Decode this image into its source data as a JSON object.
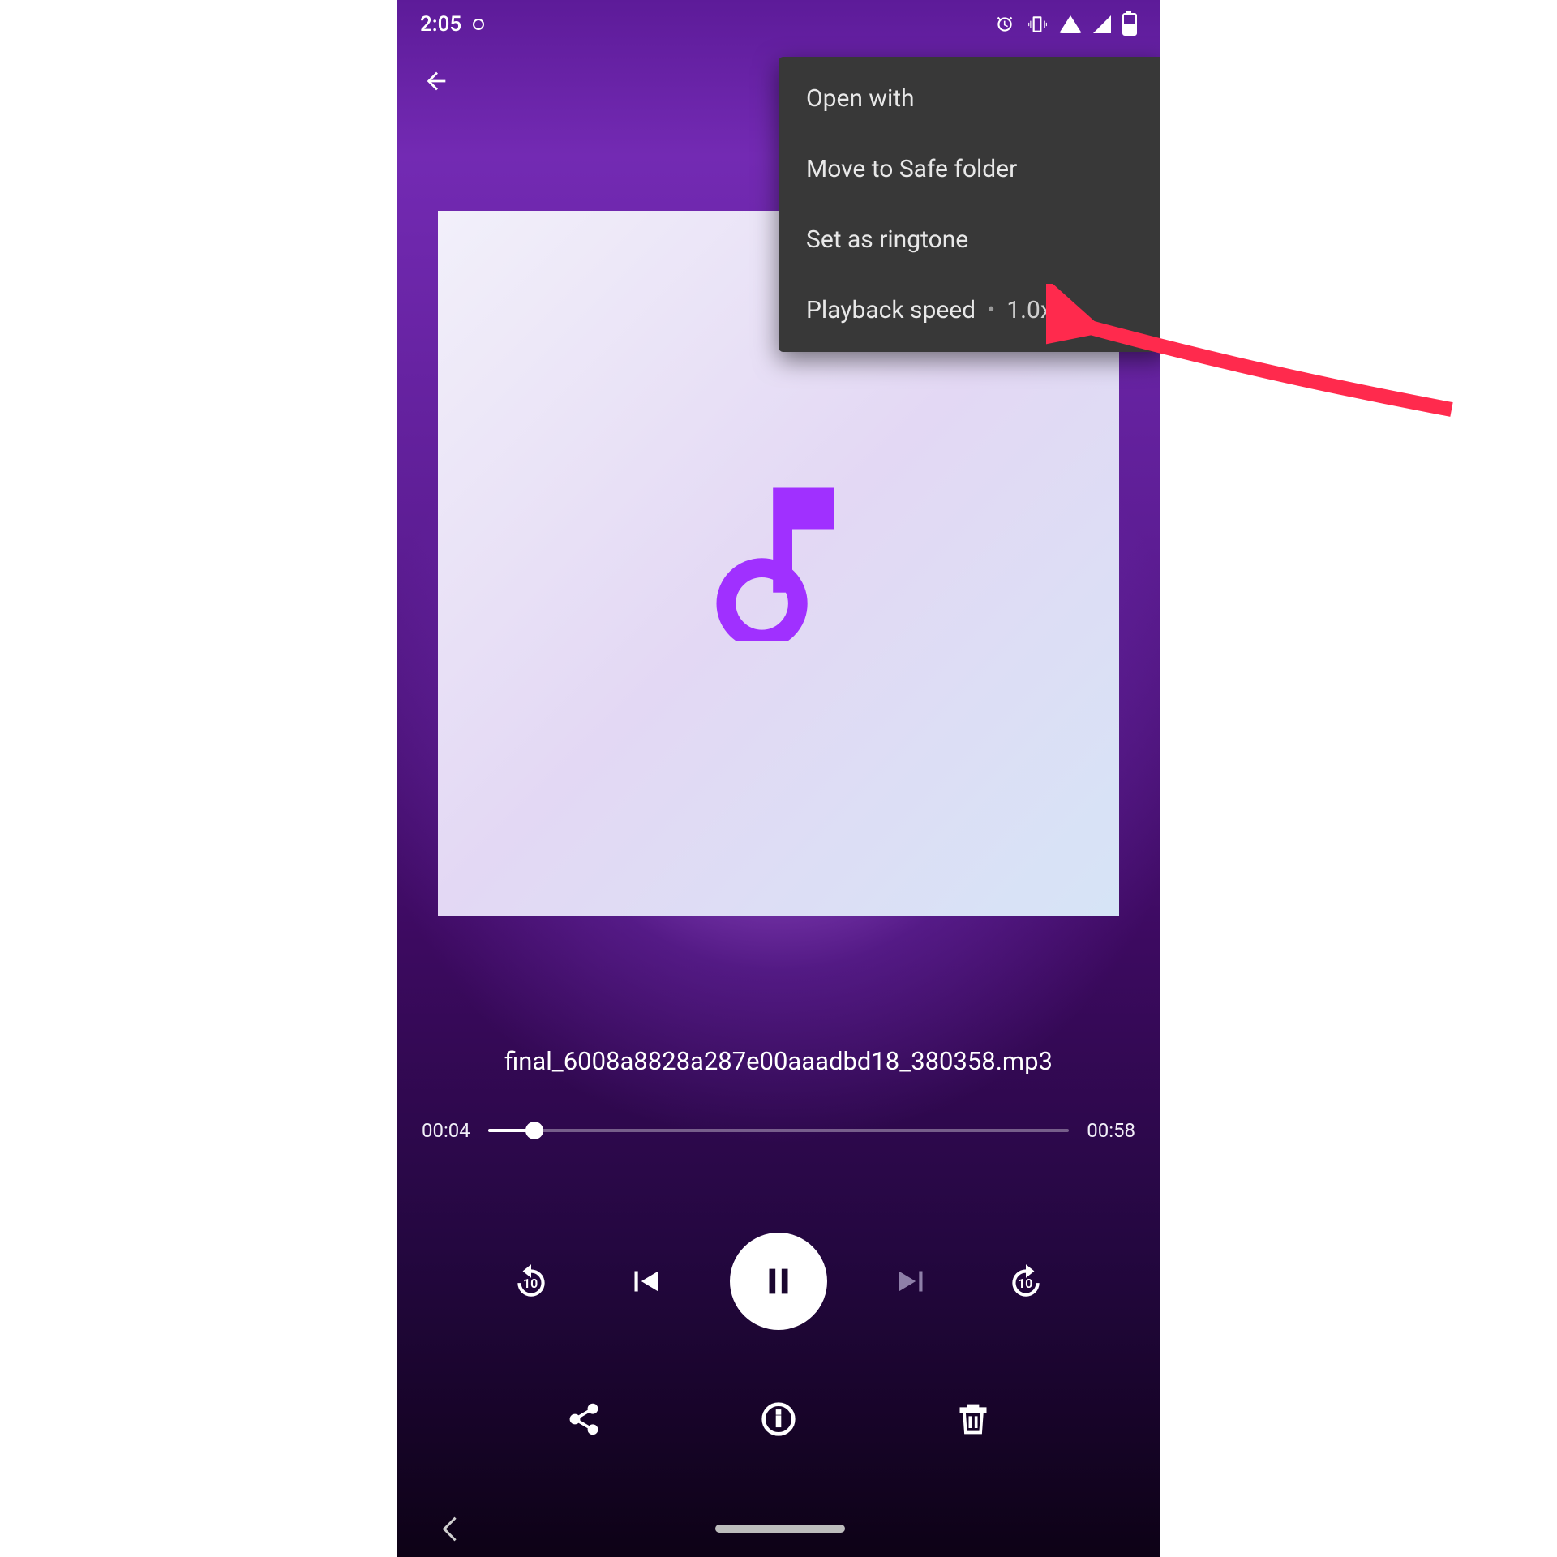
{
  "status": {
    "time": "2:05"
  },
  "menu": {
    "items": [
      {
        "label": "Open with"
      },
      {
        "label": "Move to Safe folder"
      },
      {
        "label": "Set as ringtone"
      },
      {
        "label": "Playback speed",
        "value": "1.0x"
      }
    ]
  },
  "track": {
    "name": "final_6008a8828a287e00aaadbd18_380358.mp3"
  },
  "seek": {
    "elapsed": "00:04",
    "total": "00:58"
  },
  "replay_seconds": "10",
  "forward_seconds": "10",
  "annotation": {
    "target": "Set as ringtone"
  }
}
